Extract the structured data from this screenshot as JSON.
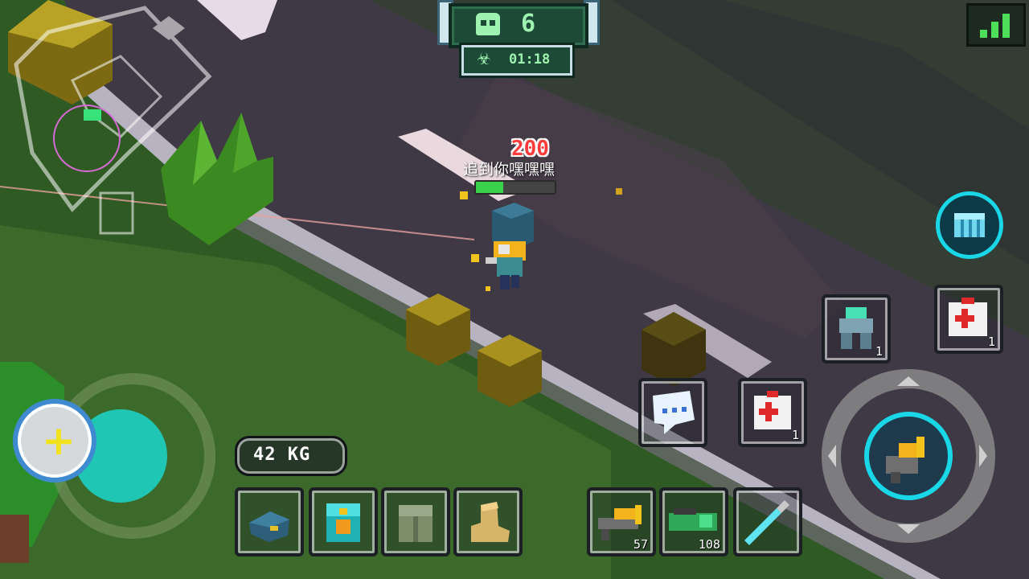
{
  "hud": {
    "zombie_count": "6",
    "timer": "01:18",
    "skull_icon": "zombie-skull-icon",
    "biohazard_icon": "biohazard-icon",
    "signal_icon": "signal-strength-icon"
  },
  "player": {
    "damage_text": "200",
    "name": "追到你嘿嘿嘿",
    "health_fraction": 0.35
  },
  "inventory": {
    "weight": "42 KG",
    "equipment": [
      {
        "name": "helmet",
        "icon": "cap-helmet-icon"
      },
      {
        "name": "backpack",
        "icon": "backpack-icon"
      },
      {
        "name": "armor",
        "icon": "vest-armor-icon"
      },
      {
        "name": "boots",
        "icon": "boots-icon"
      }
    ],
    "weapons": [
      {
        "name": "pistol",
        "icon": "blaster-gun-icon",
        "ammo": "57"
      },
      {
        "name": "rifle",
        "icon": "green-rifle-icon",
        "ammo": "108"
      },
      {
        "name": "lightsaber",
        "icon": "energy-sword-icon"
      }
    ]
  },
  "actions": {
    "turret_count": "1",
    "medkit_right_count": "1",
    "medkit_mid_count": "1"
  },
  "colors": {
    "hud_green": "#9ff3b0",
    "damage_red": "#ff3b3b",
    "accent_cyan": "#19d7e6",
    "joystick_teal": "#1fc6b4"
  }
}
